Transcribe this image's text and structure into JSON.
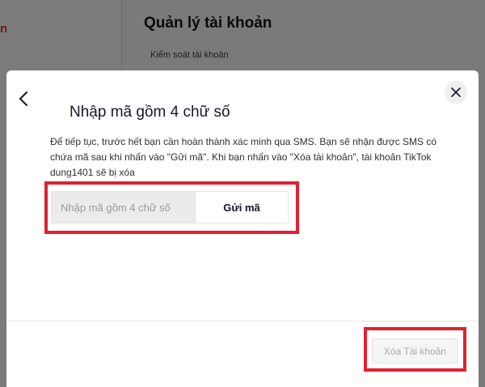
{
  "background": {
    "sidebar_accent": "n",
    "page_title": "Quản lý tài khoản",
    "section_label": "Kiểm soát tài khoản"
  },
  "modal": {
    "title": "Nhập mã gồm 4 chữ số",
    "description": "Để tiếp tục, trước hết bạn cần hoàn thành xác minh qua SMS. Bạn sẽ nhận được SMS có chứa mã sau khi nhấn vào \"Gửi mã\". Khi bạn nhấn vào \"Xóa tài khoản\", tài khoản TikTok dung1401 sẽ bị xóa",
    "code_input": {
      "value": "",
      "placeholder": "Nhập mã gồm 4 chữ số"
    },
    "send_code_label": "Gửi mã",
    "delete_account_label": "Xóa Tài khoản"
  },
  "icons": {
    "back": "chevron-left-icon",
    "close": "close-icon"
  },
  "colors": {
    "highlight": "#e32030",
    "disabled_text": "#a9a9a9",
    "overlay": "#7a7a7a"
  }
}
